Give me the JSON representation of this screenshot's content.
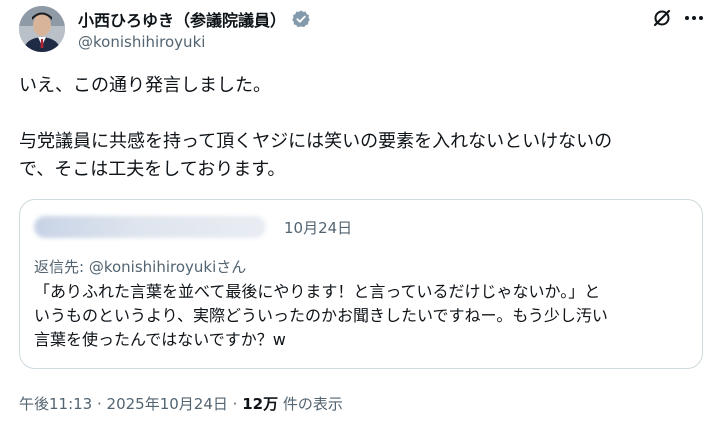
{
  "author": {
    "display_name": "小西ひろゆき（参議院議員）",
    "handle": "@konishihiroyuki",
    "verified_color": "#829aab"
  },
  "tweet": {
    "text_line1": "いえ、この通り発言しました。",
    "text_line2": "与党議員に共感を持って頂くヤジには笑いの要素を入れないといけないの",
    "text_line3": "で、そこは工夫をしております。"
  },
  "quote": {
    "date": "10月24日",
    "reply_prefix": "返信先: ",
    "reply_handle": "@konishihiroyuki",
    "reply_suffix": "さん",
    "text_line1": "「ありふれた言葉を並べて最後にやります！と言っているだけじゃないか。」と",
    "text_line2": "いうものというより、実際どういったのかお聞きしたいですねー。もう少し汚い",
    "text_line3": "言葉を使ったんではないですか？w"
  },
  "meta": {
    "time": "午後11:13",
    "separator": " · ",
    "date": "2025年10月24日",
    "views_count": "12万",
    "views_label": " 件の表示"
  },
  "icons": {
    "verified": "verified-badge-icon",
    "grok": "grok-icon",
    "more": "more-options-icon"
  },
  "colors": {
    "text": "#0f1419",
    "secondary": "#536471",
    "border": "#cfd9de"
  }
}
